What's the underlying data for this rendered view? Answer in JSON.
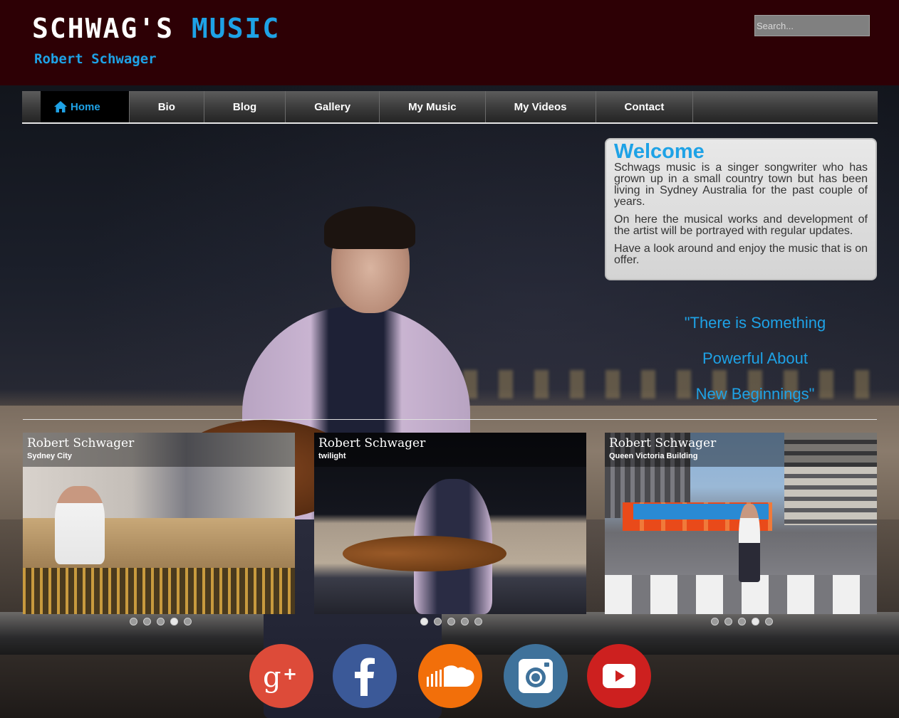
{
  "header": {
    "title_part1": "SCHWAG'S ",
    "title_part2": "MUSIC",
    "subtitle": "Robert Schwager",
    "search_placeholder": "Search..."
  },
  "nav": {
    "items": [
      {
        "label": "Home",
        "active": true,
        "icon": "home-icon"
      },
      {
        "label": "Bio"
      },
      {
        "label": "Blog"
      },
      {
        "label": "Gallery"
      },
      {
        "label": "My Music"
      },
      {
        "label": "My Videos"
      },
      {
        "label": "Contact"
      }
    ]
  },
  "welcome": {
    "heading": "Welcome",
    "paragraphs": [
      "Schwags music is a singer songwriter who has grown up in a small country town but has been living in Sydney Australia for the past couple of years.",
      "On here the musical works and development of the artist will be portrayed with regular updates.",
      "Have a look around and enjoy the music that is on offer."
    ]
  },
  "quote": {
    "lines": [
      "\"There is Something",
      "Powerful About",
      "New Beginnings\""
    ]
  },
  "cards": [
    {
      "name": "Robert Schwager",
      "place": "Sydney City",
      "dots": 5,
      "active_dot": 4
    },
    {
      "name": "Robert Schwager",
      "place": "twilight",
      "dots": 5,
      "active_dot": 1
    },
    {
      "name": "Robert Schwager",
      "place": "Queen Victoria Building",
      "dots": 5,
      "active_dot": 4
    }
  ],
  "social": [
    {
      "icon": "google-plus-icon",
      "color": "#dd4b39"
    },
    {
      "icon": "facebook-icon",
      "color": "#3b5998"
    },
    {
      "icon": "soundcloud-icon",
      "color": "#f26f0a"
    },
    {
      "icon": "instagram-icon",
      "color": "#3f729b"
    },
    {
      "icon": "youtube-icon",
      "color": "#cd201f"
    }
  ],
  "colors": {
    "accent": "#1ea2e6",
    "header_bg": "#2d0005"
  }
}
